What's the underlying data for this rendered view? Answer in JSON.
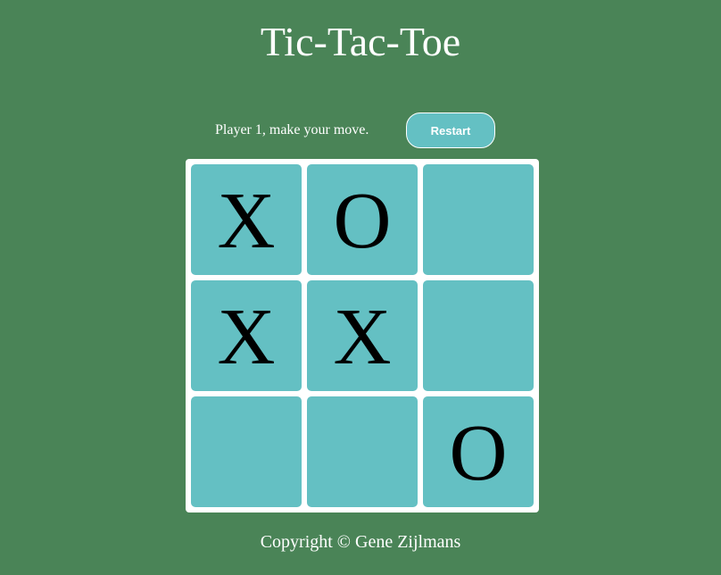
{
  "title": "Tic-Tac-Toe",
  "status": {
    "message": "Player 1, make your move.",
    "restart_label": "Restart"
  },
  "board": {
    "cells": [
      "X",
      "O",
      "",
      "X",
      "X",
      "",
      "",
      "",
      "O"
    ]
  },
  "footer": {
    "copyright": "Copyright © Gene Zijlmans"
  },
  "colors": {
    "background": "#4a8457",
    "cell": "#64c0c3",
    "board_frame": "#ffffff",
    "mark": "#000000",
    "text": "#ffffff"
  }
}
